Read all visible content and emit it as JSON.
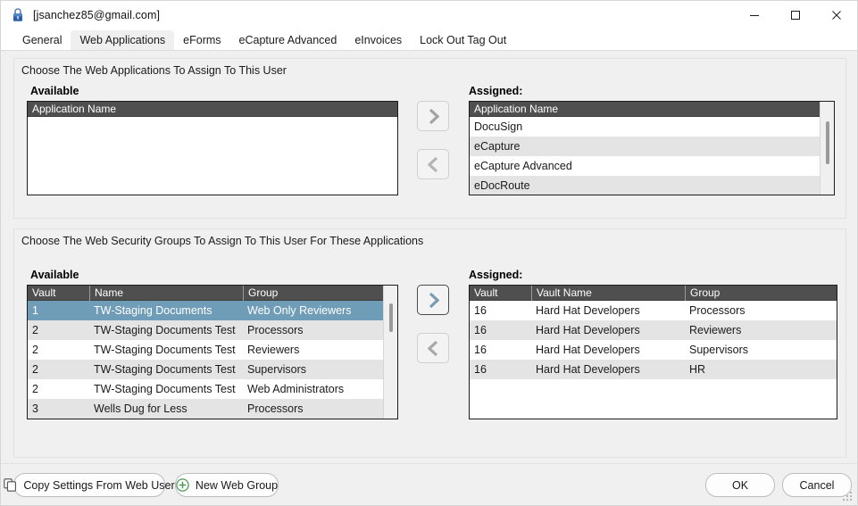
{
  "window": {
    "title": "[jsanchez85@gmail.com]",
    "icon": "lock-icon",
    "minimize_label": "Minimize",
    "maximize_label": "Maximize",
    "close_label": "Close"
  },
  "tabs": [
    {
      "label": "General",
      "active": false
    },
    {
      "label": "Web Applications",
      "active": true
    },
    {
      "label": "eForms",
      "active": false
    },
    {
      "label": "eCapture Advanced",
      "active": false
    },
    {
      "label": "eInvoices",
      "active": false
    },
    {
      "label": "Lock Out Tag Out",
      "active": false
    }
  ],
  "apps_section": {
    "caption": "Choose The Web Applications To Assign To This User",
    "available_label": "Available",
    "assigned_label": "Assigned:",
    "available": {
      "columns": [
        "Application Name"
      ],
      "sort_glyph": "△",
      "rows": []
    },
    "assigned": {
      "columns": [
        "Application Name"
      ],
      "sort_glyph": "△",
      "rows": [
        [
          "DocuSign"
        ],
        [
          "eCapture"
        ],
        [
          "eCapture Advanced"
        ],
        [
          "eDocRoute"
        ]
      ]
    },
    "add_button": "add-selected-applications",
    "remove_button": "remove-selected-applications"
  },
  "groups_section": {
    "caption": "Choose The Web Security Groups To Assign To This User For These Applications",
    "available_label": "Available",
    "assigned_label": "Assigned:",
    "available": {
      "columns": [
        "Vault",
        "Name",
        "Group"
      ],
      "sort_glyph": "△",
      "rows": [
        [
          "1",
          "TW-Staging Documents",
          "Web Only Reviewers"
        ],
        [
          "2",
          "TW-Staging Documents Test",
          "Processors"
        ],
        [
          "2",
          "TW-Staging Documents Test",
          "Reviewers"
        ],
        [
          "2",
          "TW-Staging Documents Test",
          "Supervisors"
        ],
        [
          "2",
          "TW-Staging Documents Test",
          "Web Administrators"
        ],
        [
          "3",
          "Wells Dug for Less",
          "Processors"
        ]
      ],
      "selected_row_index": 0
    },
    "assigned": {
      "columns": [
        "Vault",
        "Vault Name",
        "Group"
      ],
      "sort_glyph": "△",
      "rows": [
        [
          "16",
          "Hard Hat Developers",
          "Processors"
        ],
        [
          "16",
          "Hard Hat Developers",
          "Reviewers"
        ],
        [
          "16",
          "Hard Hat Developers",
          "Supervisors"
        ],
        [
          "16",
          "Hard Hat Developers",
          "HR"
        ]
      ]
    },
    "add_button": "add-selected-groups",
    "remove_button": "remove-selected-groups"
  },
  "footer": {
    "copy_settings_label": "Copy Settings From Web User",
    "copy_settings_icon": "copy-icon",
    "new_web_group_label": "New Web Group",
    "new_web_group_icon": "plus-circle-icon",
    "ok_label": "OK",
    "cancel_label": "Cancel"
  },
  "colors": {
    "selection": "#6f9cb6",
    "header_bar": "#4f4f4f",
    "alt_row": "#e4e4e4",
    "accent_green": "#4f9a52",
    "window_bg": "#f0f0f0"
  }
}
